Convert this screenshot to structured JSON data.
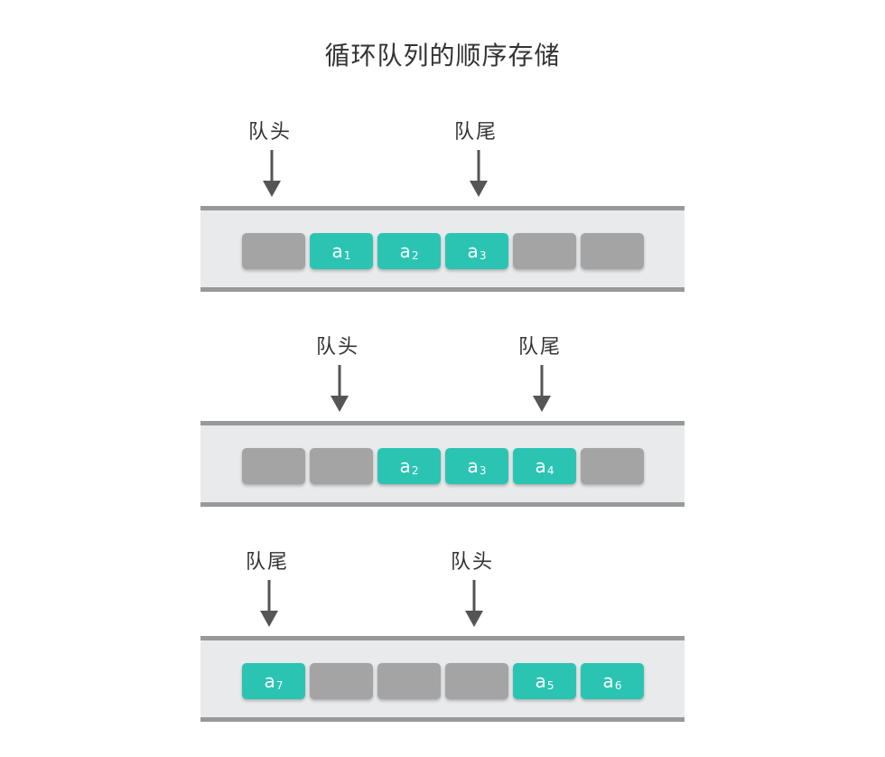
{
  "title": "循环队列的顺序存储",
  "colors": {
    "empty": "#a4a4a4",
    "filled": "#2bc4b3",
    "track": "#e9eaec",
    "rail": "#999999",
    "arrow": "#555555"
  },
  "rows": [
    {
      "pointers": [
        {
          "label": "队头",
          "cell": 0
        },
        {
          "label": "队尾",
          "cell": 3
        }
      ],
      "cells": [
        {
          "var": "",
          "sub": ""
        },
        {
          "var": "a",
          "sub": "1"
        },
        {
          "var": "a",
          "sub": "2"
        },
        {
          "var": "a",
          "sub": "3"
        },
        {
          "var": "",
          "sub": ""
        },
        {
          "var": "",
          "sub": ""
        }
      ]
    },
    {
      "pointers": [
        {
          "label": "队头",
          "cell": 1
        },
        {
          "label": "队尾",
          "cell": 4
        }
      ],
      "cells": [
        {
          "var": "",
          "sub": ""
        },
        {
          "var": "",
          "sub": ""
        },
        {
          "var": "a",
          "sub": "2"
        },
        {
          "var": "a",
          "sub": "3"
        },
        {
          "var": "a",
          "sub": "4"
        },
        {
          "var": "",
          "sub": ""
        }
      ]
    },
    {
      "pointers": [
        {
          "label": "队尾",
          "cell": 0
        },
        {
          "label": "队头",
          "cell": 3
        }
      ],
      "cells": [
        {
          "var": "a",
          "sub": "7"
        },
        {
          "var": "",
          "sub": ""
        },
        {
          "var": "",
          "sub": ""
        },
        {
          "var": "",
          "sub": ""
        },
        {
          "var": "a",
          "sub": "5"
        },
        {
          "var": "a",
          "sub": "6"
        }
      ]
    }
  ]
}
